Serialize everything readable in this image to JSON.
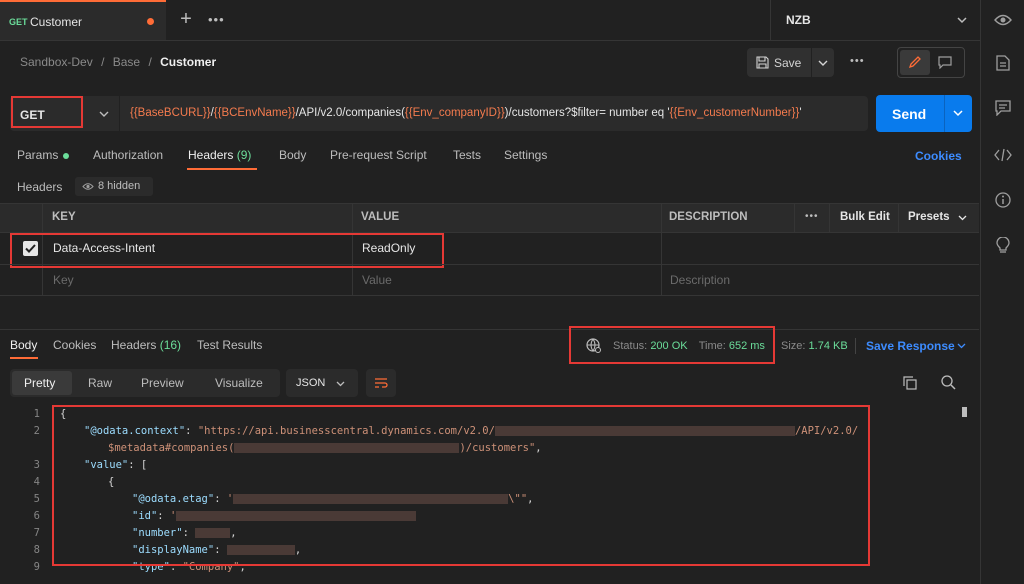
{
  "tabs": [
    {
      "method": "GET",
      "label": "Customer"
    }
  ],
  "environment": "NZB",
  "breadcrumb": {
    "workspace": "Sandbox-Dev",
    "folder": "Base",
    "request": "Customer"
  },
  "toolbar": {
    "save_label": "Save"
  },
  "request": {
    "method": "GET",
    "url_parts": [
      {
        "t": "{{BaseBCURL}}",
        "v": true
      },
      {
        "t": "/",
        "v": false
      },
      {
        "t": "{{BCEnvName}}",
        "v": true
      },
      {
        "t": "/API/v2.0/companies(",
        "v": false
      },
      {
        "t": "{{Env_companyID}}",
        "v": true
      },
      {
        "t": ")/customers?$filter= number eq '",
        "v": false
      },
      {
        "t": "{{Env_customerNumber}}",
        "v": true
      },
      {
        "t": "'",
        "v": false
      }
    ],
    "send_label": "Send"
  },
  "request_tabs": [
    {
      "label": "Params",
      "badge": ""
    },
    {
      "label": "Authorization",
      "badge": ""
    },
    {
      "label": "Headers",
      "badge": "(9)"
    },
    {
      "label": "Body",
      "badge": ""
    },
    {
      "label": "Pre-request Script",
      "badge": ""
    },
    {
      "label": "Tests",
      "badge": ""
    },
    {
      "label": "Settings",
      "badge": ""
    }
  ],
  "cookies_label": "Cookies",
  "headers_section": {
    "title": "Headers",
    "hidden": "8 hidden"
  },
  "headers_table": {
    "columns": {
      "key": "KEY",
      "value": "VALUE",
      "description": "DESCRIPTION"
    },
    "bulk_edit": "Bulk Edit",
    "presets": "Presets",
    "rows": [
      {
        "key": "Data-Access-Intent",
        "value": "ReadOnly",
        "checked": true
      }
    ],
    "placeholders": {
      "key": "Key",
      "value": "Value",
      "description": "Description"
    }
  },
  "response_tabs": [
    {
      "label": "Body",
      "badge": ""
    },
    {
      "label": "Cookies",
      "badge": ""
    },
    {
      "label": "Headers",
      "badge": "(16)"
    },
    {
      "label": "Test Results",
      "badge": ""
    }
  ],
  "response_status": {
    "status_label": "Status:",
    "status_value": "200 OK",
    "time_label": "Time:",
    "time_value": "652 ms",
    "size_label": "Size:",
    "size_value": "1.74 KB",
    "save_response": "Save Response"
  },
  "view_tabs": [
    "Pretty",
    "Raw",
    "Preview",
    "Visualize"
  ],
  "format": "JSON",
  "code_lines": [
    {
      "n": "1",
      "parts": [
        {
          "c": "p",
          "t": "{"
        }
      ]
    },
    {
      "n": "2",
      "parts": [
        {
          "c": "k",
          "t": "\"@odata.context\""
        },
        {
          "c": "p",
          "t": ": "
        },
        {
          "c": "s",
          "t": "\"https://api.businesscentral.dynamics.com/v2.0/"
        },
        {
          "c": "r",
          "w": 300
        },
        {
          "c": "s",
          "t": "/API/v2.0/"
        }
      ]
    },
    {
      "n": "",
      "parts": [
        {
          "c": "s",
          "t": "$metadata#companies("
        },
        {
          "c": "r",
          "w": 225
        },
        {
          "c": "s",
          "t": ")/customers\""
        },
        {
          "c": "p",
          "t": ","
        }
      ]
    },
    {
      "n": "3",
      "parts": [
        {
          "c": "k",
          "t": "\"value\""
        },
        {
          "c": "p",
          "t": ": ["
        }
      ]
    },
    {
      "n": "4",
      "parts": [
        {
          "c": "p",
          "t": "{"
        }
      ]
    },
    {
      "n": "5",
      "parts": [
        {
          "c": "k",
          "t": "\"@odata.etag\""
        },
        {
          "c": "p",
          "t": ": "
        },
        {
          "c": "s",
          "t": "'"
        },
        {
          "c": "r",
          "w": 275
        },
        {
          "c": "s",
          "t": "\\\"\""
        },
        {
          "c": "p",
          "t": ","
        }
      ]
    },
    {
      "n": "6",
      "parts": [
        {
          "c": "k",
          "t": "\"id\""
        },
        {
          "c": "p",
          "t": ": "
        },
        {
          "c": "s",
          "t": "'"
        },
        {
          "c": "r",
          "w": 240
        }
      ]
    },
    {
      "n": "7",
      "parts": [
        {
          "c": "k",
          "t": "\"number\""
        },
        {
          "c": "p",
          "t": ": "
        },
        {
          "c": "r",
          "w": 35
        },
        {
          "c": "p",
          "t": ","
        }
      ]
    },
    {
      "n": "8",
      "parts": [
        {
          "c": "k",
          "t": "\"displayName\""
        },
        {
          "c": "p",
          "t": ": "
        },
        {
          "c": "r",
          "w": 68
        },
        {
          "c": "p",
          "t": ","
        }
      ]
    },
    {
      "n": "9",
      "parts": [
        {
          "c": "k",
          "t": "\"type\""
        },
        {
          "c": "p",
          "t": ": "
        },
        {
          "c": "s",
          "t": "\"Company\""
        },
        {
          "c": "p",
          "t": ","
        }
      ]
    }
  ],
  "colors": {
    "accent": "#ff6c37",
    "send": "#097bed",
    "link": "#3d8cff",
    "success": "#6bdd9a",
    "highlight": "#e53935"
  }
}
